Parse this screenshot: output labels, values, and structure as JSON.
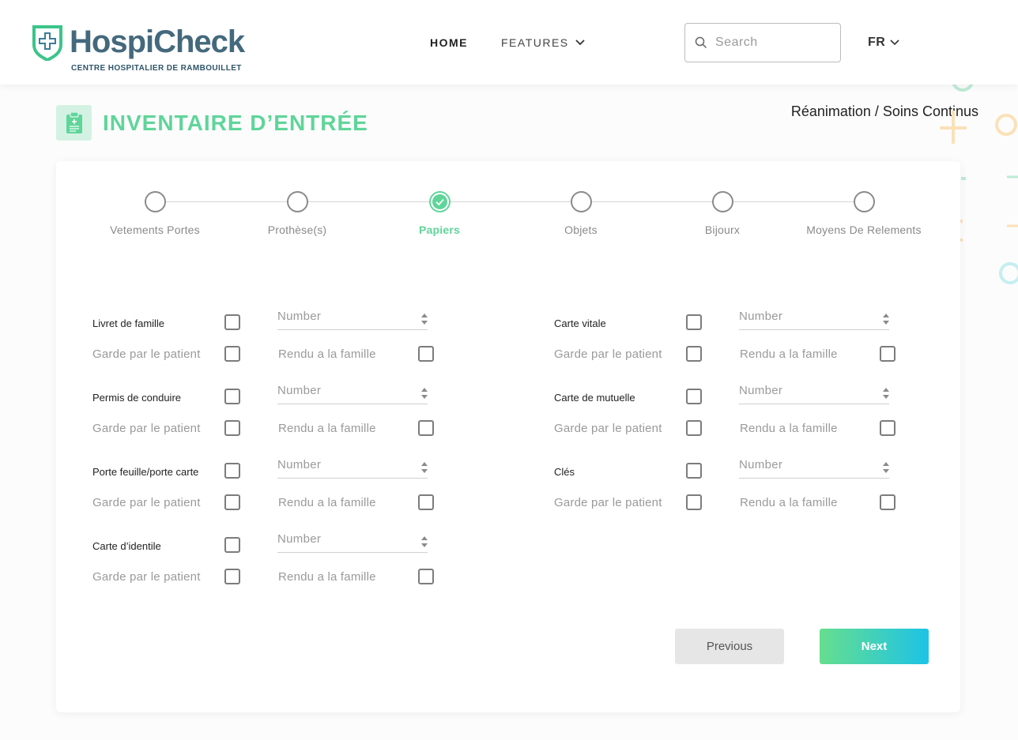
{
  "header": {
    "logo_name": "HospiCheck",
    "logo_subtitle": "CENTRE HOSPITALIER DE RAMBOUILLET",
    "nav": {
      "home": "HOME",
      "features": "FEATURES"
    },
    "search_placeholder": "Search",
    "language": "FR"
  },
  "page": {
    "title": "INVENTAIRE D’ENTRÉE",
    "breadcrumb": "Réanimation / Soins Continus"
  },
  "stepper": {
    "active_index": 2,
    "steps": [
      "Vetements Portes",
      "Prothèse(s)",
      "Papiers",
      "Objets",
      "Bijourx",
      "Moyens De Relements"
    ]
  },
  "form": {
    "number_placeholder": "Number",
    "kept_label": "Garde par le patient",
    "returned_label": "Rendu a la famille",
    "left_items": [
      "Livret de famille",
      "Permis de conduire",
      "Porte feuille/porte carte",
      "Carte d’identile"
    ],
    "right_items": [
      "Carte vitale",
      "Carte de mutuelle",
      "Clés"
    ]
  },
  "buttons": {
    "previous": "Previous",
    "next": "Next"
  },
  "colors": {
    "accent_green": "#5fd59a",
    "brand_blue": "#44697d",
    "next_gradient_start": "#66de8e",
    "next_gradient_end": "#1dc3e6"
  }
}
